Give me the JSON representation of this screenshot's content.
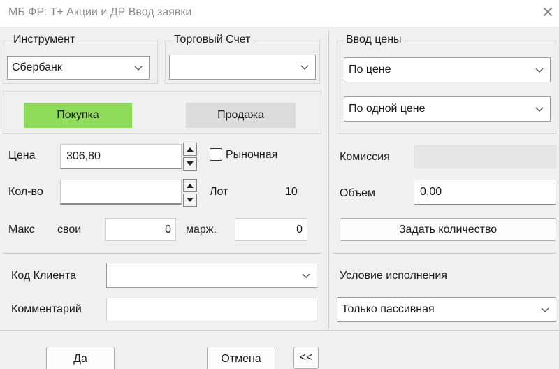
{
  "window": {
    "title": "МБ ФР: Т+ Акции и ДР Ввод заявки",
    "close_glyph": "✕"
  },
  "instrument": {
    "legend": "Инструмент",
    "value": "Сбербанк"
  },
  "account": {
    "legend": "Торговый Счет",
    "value": ""
  },
  "price_entry": {
    "legend": "Ввод цены",
    "mode": "По цене",
    "mode2": "По одной цене"
  },
  "side": {
    "buy": "Покупка",
    "sell": "Продажа"
  },
  "price": {
    "label": "Цена",
    "value": "306,80",
    "market_label": "Рыночная"
  },
  "qty": {
    "label": "Кол-во",
    "value": "",
    "lot_label": "Лот",
    "lot_value": "10"
  },
  "max": {
    "label": "Макс",
    "own_label": "свои",
    "own_value": "0",
    "margin_label": "марж.",
    "margin_value": "0"
  },
  "commission": {
    "label": "Комиссия",
    "value": ""
  },
  "volume": {
    "label": "Объем",
    "value": "0,00"
  },
  "set_qty_button": "Задать количество",
  "client": {
    "label": "Код Клиента",
    "value": ""
  },
  "comment": {
    "label": "Комментарий",
    "value": ""
  },
  "execution": {
    "label": "Условие исполнения",
    "value": "Только пассивная"
  },
  "buttons": {
    "ok": "Да",
    "cancel": "Отмена",
    "collapse": "<<"
  },
  "colors": {
    "buy": "#8fdc5b",
    "sell": "#dcdcdc",
    "background": "#f0f0f0"
  }
}
